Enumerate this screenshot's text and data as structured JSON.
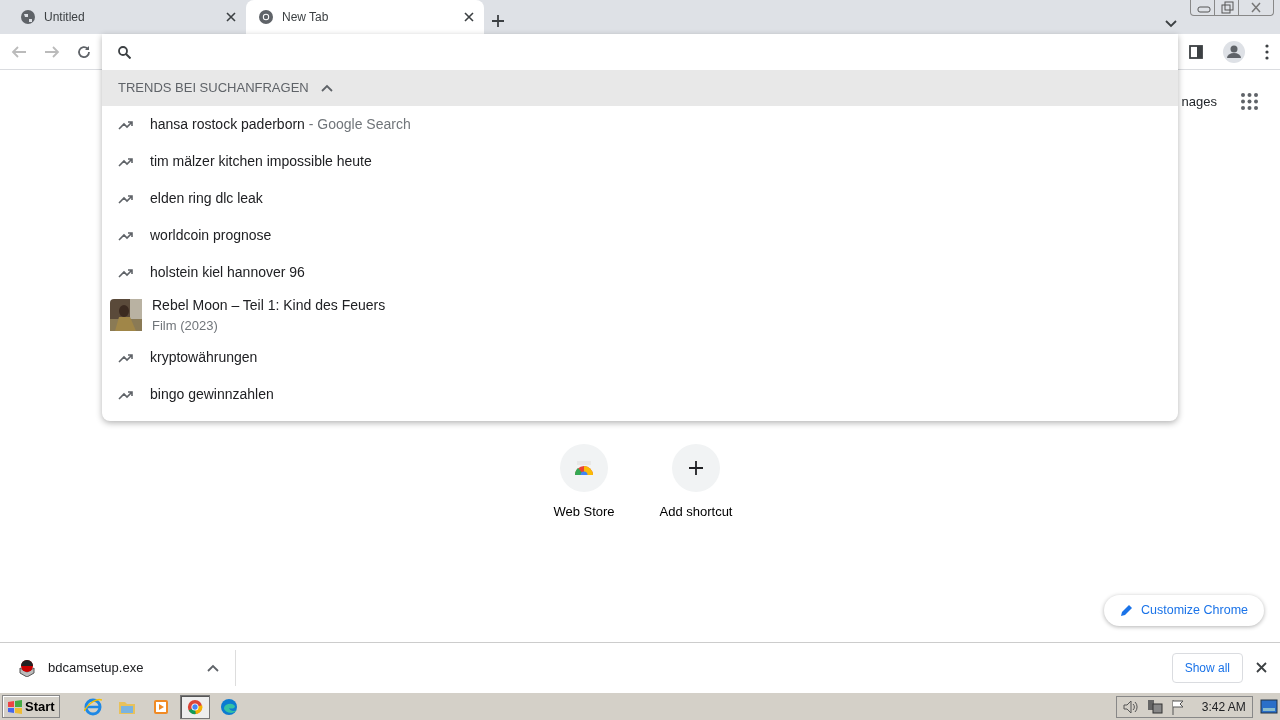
{
  "tabs": [
    {
      "title": "Untitled",
      "kind": "web",
      "selected": false
    },
    {
      "title": "New Tab",
      "kind": "newtab",
      "selected": true
    }
  ],
  "omnibox": {
    "section_header": "TRENDS BEI SUCHANFRAGEN",
    "suggestions": [
      {
        "kind": "trend",
        "text": "hansa rostock paderborn",
        "suffix": "- Google Search"
      },
      {
        "kind": "trend",
        "text": "tim mälzer kitchen impossible heute"
      },
      {
        "kind": "trend",
        "text": "elden ring dlc leak"
      },
      {
        "kind": "trend",
        "text": "worldcoin prognose"
      },
      {
        "kind": "trend",
        "text": "holstein kiel hannover 96"
      },
      {
        "kind": "entity",
        "text": "Rebel Moon – Teil 1: Kind des Feuers",
        "subtitle": "Film (2023)"
      },
      {
        "kind": "trend",
        "text": "kryptowährungen"
      },
      {
        "kind": "trend",
        "text": "bingo gewinnzahlen"
      }
    ]
  },
  "page": {
    "header_link": "nages",
    "shortcuts": [
      {
        "kind": "webstore",
        "label": "Web Store"
      },
      {
        "kind": "add",
        "label": "Add shortcut"
      }
    ],
    "customize_button": "Customize Chrome"
  },
  "downloads": {
    "items": [
      {
        "filename": "bdcamsetup.exe"
      }
    ],
    "show_all": "Show all"
  },
  "taskbar": {
    "start": "Start",
    "apps": [
      {
        "kind": "ie",
        "active": false
      },
      {
        "kind": "folder",
        "active": false
      },
      {
        "kind": "media",
        "active": false
      },
      {
        "kind": "chrome",
        "active": true
      },
      {
        "kind": "edge",
        "active": false
      }
    ],
    "clock": "3:42 AM"
  }
}
